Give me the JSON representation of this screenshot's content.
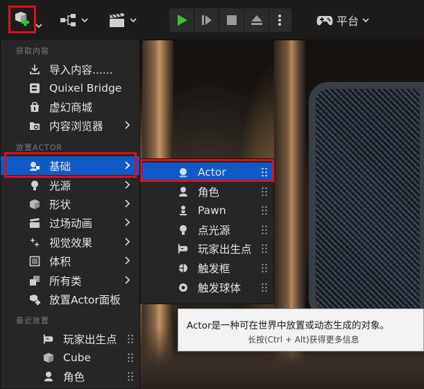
{
  "toolbar": {
    "platform_label": "平台"
  },
  "menu": {
    "section_get": "获取内容",
    "items_get": [
      {
        "label": "导入内容......",
        "icon": "import-icon"
      },
      {
        "label": "Quixel Bridge",
        "icon": "quixel-bridge-icon"
      },
      {
        "label": "虚幻商城",
        "icon": "marketplace-icon"
      },
      {
        "label": "内容浏览器",
        "icon": "content-browser-icon"
      }
    ],
    "section_place": "放置ACTOR",
    "items_place": [
      {
        "label": "基础",
        "icon": "basic-actor-icon"
      },
      {
        "label": "光源",
        "icon": "light-bulb-icon"
      },
      {
        "label": "形状",
        "icon": "shape-cube-icon"
      },
      {
        "label": "过场动画",
        "icon": "clapperboard-icon"
      },
      {
        "label": "视觉效果",
        "icon": "visual-effects-icon"
      },
      {
        "label": "体积",
        "icon": "volume-icon"
      },
      {
        "label": "所有类",
        "icon": "all-classes-icon"
      },
      {
        "label": "放置Actor面板",
        "icon": "place-actors-panel-icon"
      }
    ],
    "section_recent": "最近放置",
    "items_recent": [
      {
        "label": "玩家出生点",
        "icon": "gamepad-icon"
      },
      {
        "label": "Cube",
        "icon": "cube-icon"
      },
      {
        "label": "角色",
        "icon": "character-icon"
      }
    ]
  },
  "submenu": {
    "items": [
      {
        "label": "Actor",
        "icon": "actor-sphere-icon"
      },
      {
        "label": "角色",
        "icon": "character-icon"
      },
      {
        "label": "Pawn",
        "icon": "pawn-icon"
      },
      {
        "label": "点光源",
        "icon": "point-light-icon"
      },
      {
        "label": "玩家出生点",
        "icon": "gamepad-icon"
      },
      {
        "label": "触发框",
        "icon": "trigger-box-icon"
      },
      {
        "label": "触发球体",
        "icon": "trigger-sphere-icon"
      }
    ]
  },
  "tooltip": {
    "title": "Actor是一种可在世界中放置或动态生成的对象。",
    "hint": "长按(Ctrl + Alt)获得更多信息"
  },
  "colors": {
    "selection": "#0f5ac7",
    "highlight_border": "#e0101a",
    "play_green": "#3ac13a"
  }
}
